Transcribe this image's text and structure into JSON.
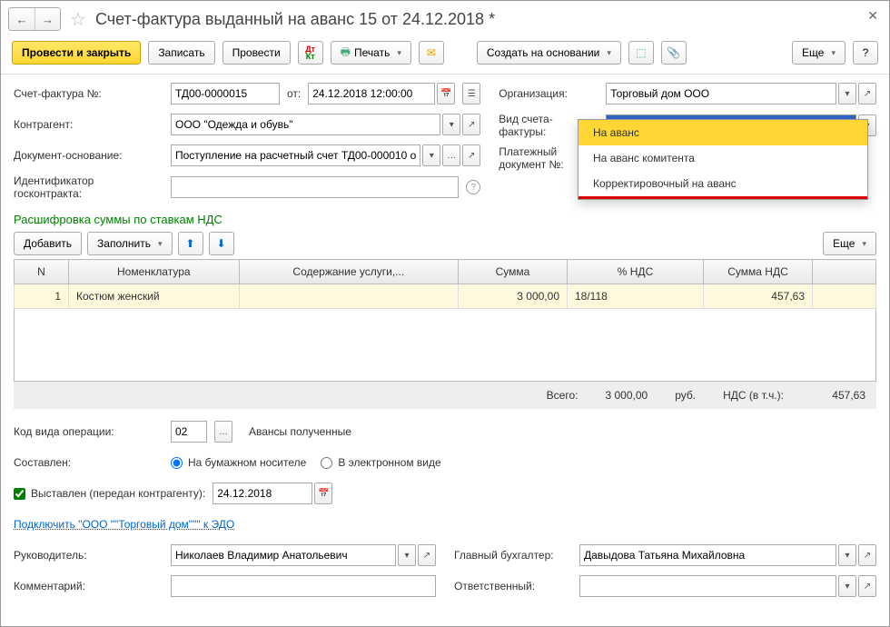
{
  "title": "Счет-фактура выданный на аванс 15 от 24.12.2018 *",
  "toolbar": {
    "post_close": "Провести и закрыть",
    "save": "Записать",
    "post": "Провести",
    "print": "Печать",
    "create_based": "Создать на основании",
    "more": "Еще",
    "help": "?"
  },
  "fields": {
    "invoice_no_lbl": "Счет-фактура №:",
    "invoice_no": "ТД00-0000015",
    "from_lbl": "от:",
    "date": "24.12.2018 12:00:00",
    "org_lbl": "Организация:",
    "org": "Торговый дом ООО",
    "counterparty_lbl": "Контрагент:",
    "counterparty": "ООО \"Одежда и обувь\"",
    "invoice_type_lbl": "Вид счета-фактуры:",
    "invoice_type": "На аванс",
    "basis_lbl": "Документ-основание:",
    "basis": "Поступление на расчетный счет ТД00-000010 о",
    "payment_doc_lbl": "Платежный документ №:",
    "gov_contract_lbl": "Идентификатор госконтракта:"
  },
  "dropdown": {
    "opt1": "На аванс",
    "opt2": "На аванс комитента",
    "opt3": "Корректировочный на аванс"
  },
  "vat_section": {
    "header": "Расшифровка суммы по ставкам НДС",
    "add": "Добавить",
    "fill": "Заполнить",
    "more": "Еще",
    "cols": {
      "n": "N",
      "nomen": "Номенклатура",
      "service": "Содержание услуги,...",
      "sum": "Сумма",
      "vat_rate": "% НДС",
      "vat_sum": "Сумма НДС"
    },
    "rows": [
      {
        "n": "1",
        "nomen": "Костюм женский",
        "service": "",
        "sum": "3 000,00",
        "vat_rate": "18/118",
        "vat_sum": "457,63"
      }
    ],
    "totals": {
      "total_lbl": "Всего:",
      "total": "3 000,00",
      "currency": "руб.",
      "vat_lbl": "НДС (в т.ч.):",
      "vat": "457,63"
    }
  },
  "footer": {
    "op_code_lbl": "Код вида операции:",
    "op_code": "02",
    "op_code_desc": "Авансы полученные",
    "composed_lbl": "Составлен:",
    "paper": "На бумажном носителе",
    "electronic": "В электронном виде",
    "issued_lbl": "Выставлен (передан контрагенту):",
    "issued_date": "24.12.2018",
    "edo_link": "Подключить \"ООО \"\"Торговый дом\"\"\" к ЭДО",
    "director_lbl": "Руководитель:",
    "director": "Николаев Владимир Анатольевич",
    "accountant_lbl": "Главный бухгалтер:",
    "accountant": "Давыдова Татьяна Михайловна",
    "comment_lbl": "Комментарий:",
    "responsible_lbl": "Ответственный:"
  }
}
